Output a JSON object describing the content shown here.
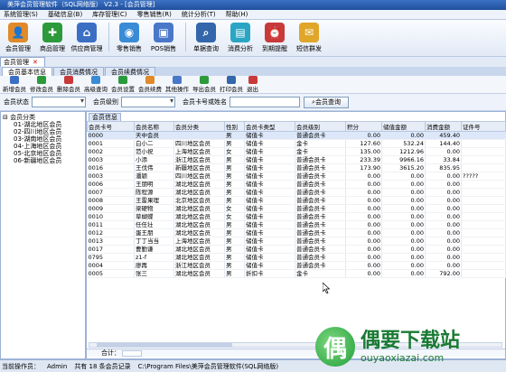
{
  "window": {
    "title": "美萍会员管理软件（SQL网络版） V2.3 - [会员管理]"
  },
  "menu": [
    "系统管理(S)",
    "基础信息(B)",
    "库存管理(C)",
    "零售销售(R)",
    "统计分析(T)",
    "帮助(H)"
  ],
  "toolbar": [
    {
      "label": "会员管理",
      "icon": "member-icon",
      "color": "#e08a2a"
    },
    {
      "label": "商品管理",
      "icon": "goods-icon",
      "color": "#2c9a3a"
    },
    {
      "label": "供应商管理",
      "icon": "supplier-icon",
      "color": "#3b6fc4"
    },
    {
      "label": "零售销售",
      "icon": "sales-icon",
      "color": "#3a8bd6"
    },
    {
      "label": "POS销售",
      "icon": "pos-icon",
      "color": "#4a78c8"
    },
    {
      "label": "单据查询",
      "icon": "query-icon",
      "color": "#3366aa"
    },
    {
      "label": "消费分析",
      "icon": "analysis-icon",
      "color": "#2aa6c4"
    },
    {
      "label": "到期提醒",
      "icon": "alarm-icon",
      "color": "#c83a3a"
    },
    {
      "label": "短信群发",
      "icon": "sms-icon",
      "color": "#e0a62a"
    }
  ],
  "doc_tab": {
    "label": "会员管理"
  },
  "sub_tabs": [
    "会员基本信息",
    "会员消费情况",
    "会员续费情况"
  ],
  "actions": [
    {
      "label": "新增会员",
      "color": "#3b6fc4"
    },
    {
      "label": "修改会员",
      "color": "#2c9a3a"
    },
    {
      "label": "删除会员",
      "color": "#c83a3a"
    },
    {
      "label": "高级查询",
      "color": "#3a8bd6"
    },
    {
      "label": "会员设置",
      "color": "#2c9a3a"
    },
    {
      "label": "会员续费",
      "color": "#e08a2a"
    },
    {
      "label": "其他操作",
      "color": "#4a78c8"
    },
    {
      "label": "导出会员",
      "color": "#2c9a3a"
    },
    {
      "label": "打印会员",
      "color": "#3366aa"
    },
    {
      "label": "退出",
      "color": "#c83a3a"
    }
  ],
  "filters": {
    "status_label": "会员状态",
    "level_label": "会员级别",
    "search_label": "会员卡号或姓名",
    "search_value": "",
    "query_button": "会员查询"
  },
  "tree": {
    "root": "会员分类",
    "children": [
      "01-湖北地区会员",
      "02-四川地区会员",
      "03-湖南地区会员",
      "04-上海地区会员",
      "05-北京地区会员",
      "06-新疆地区会员"
    ]
  },
  "grid": {
    "title": "会员信息",
    "columns": [
      "会员卡号",
      "会员名称",
      "会员分类",
      "性别",
      "会员卡类型",
      "会员级别",
      "积分",
      "储值金额",
      "消费金额",
      "证件号"
    ],
    "rows": [
      [
        "0000",
        "天中会员",
        "",
        "男",
        "储值卡",
        "普通会员卡",
        "0.00",
        "0.00",
        "459.40",
        ""
      ],
      [
        "0001",
        "白小二",
        "四川地区会员",
        "男",
        "储值卡",
        "金卡",
        "127.60",
        "532.24",
        "144.40",
        ""
      ],
      [
        "0002",
        "范小祝",
        "上海地区会员",
        "女",
        "储值卡",
        "金卡",
        "135.00",
        "1212.96",
        "0.00",
        ""
      ],
      [
        "0003",
        "小添",
        "浙江地区会员",
        "男",
        "储值卡",
        "普通会员卡",
        "233.39",
        "9966.16",
        "33.84",
        ""
      ],
      [
        "0016",
        "王伐伟",
        "新疆地区会员",
        "男",
        "储值卡",
        "普通会员卡",
        "173.90",
        "3615.20",
        "835.95",
        ""
      ],
      [
        "0003",
        "潘颖",
        "四川地区会员",
        "男",
        "储值卡",
        "普通会员卡",
        "0.00",
        "0.00",
        "0.00",
        "?????"
      ],
      [
        "0006",
        "王朋明",
        "湖北地区会员",
        "男",
        "储值卡",
        "普通会员卡",
        "0.00",
        "0.00",
        "0.00",
        ""
      ],
      [
        "0007",
        "陈程源",
        "湖北地区会员",
        "男",
        "储值卡",
        "普通会员卡",
        "0.00",
        "0.00",
        "0.00",
        ""
      ],
      [
        "0008",
        "王雷果理",
        "北京地区会员",
        "男",
        "储值卡",
        "普通会员卡",
        "0.00",
        "0.00",
        "0.00",
        ""
      ],
      [
        "0009",
        "梁硬物",
        "湖北地区会员",
        "女",
        "储值卡",
        "普通会员卡",
        "0.00",
        "0.00",
        "0.00",
        ""
      ],
      [
        "0010",
        "草蝴蝶",
        "湖北地区会员",
        "女",
        "储值卡",
        "普通会员卡",
        "0.00",
        "0.00",
        "0.00",
        ""
      ],
      [
        "0011",
        "任任壮",
        "湖北地区会员",
        "男",
        "储值卡",
        "普通会员卡",
        "0.00",
        "0.00",
        "0.00",
        ""
      ],
      [
        "0012",
        "蛋王朋",
        "湖北地区会员",
        "男",
        "储值卡",
        "普通会员卡",
        "0.00",
        "0.00",
        "0.00",
        ""
      ],
      [
        "0013",
        "丁丁当当",
        "上海地区会员",
        "男",
        "储值卡",
        "普通会员卡",
        "0.00",
        "0.00",
        "0.00",
        ""
      ],
      [
        "0017",
        "曹勤谦",
        "湖北地区会员",
        "男",
        "储值卡",
        "普通会员卡",
        "0.00",
        "0.00",
        "0.00",
        ""
      ],
      [
        "0795",
        "z1-f",
        "湖北地区会员",
        "男",
        "储值卡",
        "普通会员卡",
        "0.00",
        "0.00",
        "0.00",
        ""
      ],
      [
        "0004",
        "廖再",
        "浙江地区会员",
        "男",
        "储值卡",
        "普通会员卡",
        "0.00",
        "0.00",
        "0.00",
        ""
      ],
      [
        "0005",
        "张三",
        "湖北地区会员",
        "男",
        "折扣卡",
        "金卡",
        "0.00",
        "0.00",
        "792.00",
        ""
      ]
    ],
    "footer_label": "合计："
  },
  "statusbar": {
    "operator_label": "当前操作员：",
    "operator": "Admin",
    "records": "共有 18 条会员记录",
    "path": "C:\\Program Files\\美萍会员管理软件(SQL网络版)"
  },
  "watermark": {
    "title": "偶要下载站",
    "url": "ouyaoxiazai.com",
    "logo_char": "偶"
  }
}
